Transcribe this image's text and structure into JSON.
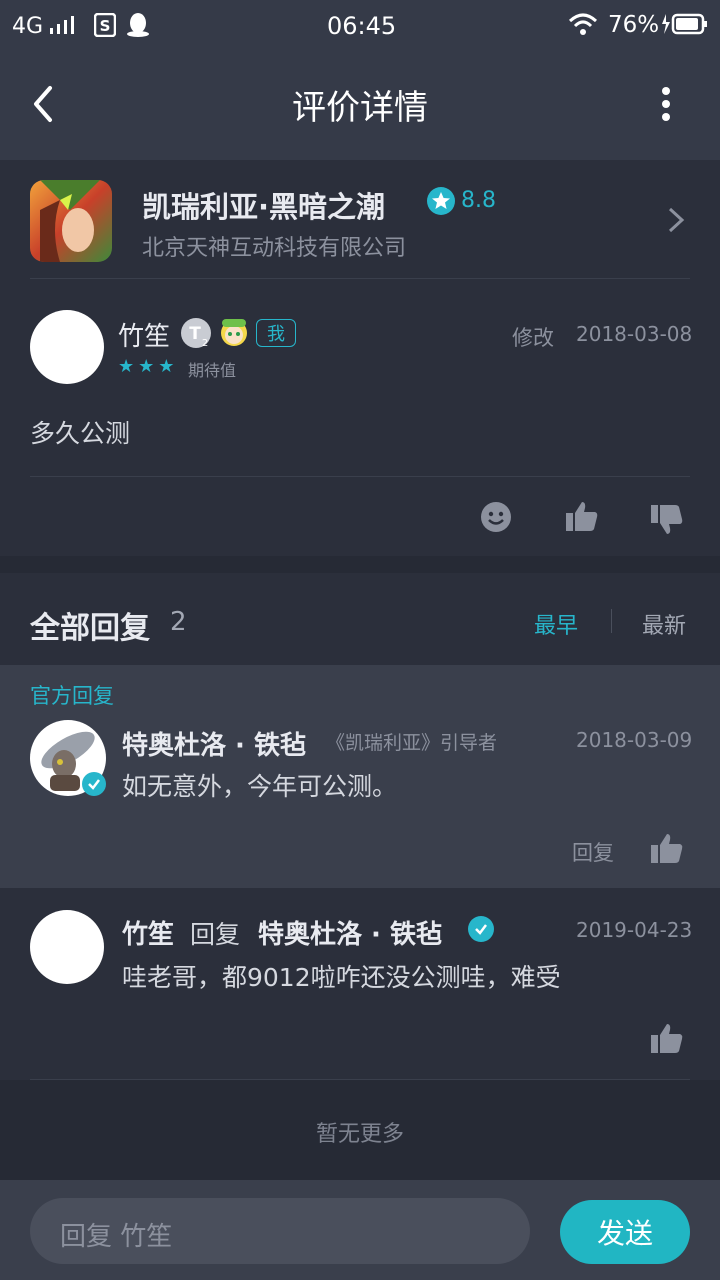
{
  "status": {
    "network": "4G",
    "time": "06:45",
    "battery": "76%"
  },
  "header": {
    "title": "评价详情"
  },
  "game": {
    "name": "凯瑞利亚·黑暗之潮",
    "rating": "8.8",
    "developer": "北京天神互动科技有限公司"
  },
  "review": {
    "username": "竹笙",
    "me_tag": "我",
    "stars": 3,
    "stars_label": "期待值",
    "edit_label": "修改",
    "date": "2018-03-08",
    "content": "多久公测"
  },
  "replies": {
    "title": "全部回复",
    "count": "2",
    "sort_earliest": "最早",
    "sort_latest": "最新",
    "official_label": "官方回复",
    "official": {
      "username": "特奥杜洛 · 铁毡",
      "role": "《凯瑞利亚》引导者",
      "date": "2018-03-09",
      "content": "如无意外，今年可公测。",
      "reply_label": "回复"
    },
    "reply2": {
      "username": "竹笙",
      "reply_word": "回复",
      "target": "特奥杜洛 · 铁毡",
      "date": "2019-04-23",
      "content": "哇老哥，都9012啦咋还没公测哇，难受"
    },
    "no_more": "暂无更多"
  },
  "footer": {
    "placeholder": "回复 竹笙",
    "send": "发送"
  },
  "colors": {
    "accent": "#27b6cb",
    "background": "#262a35"
  }
}
